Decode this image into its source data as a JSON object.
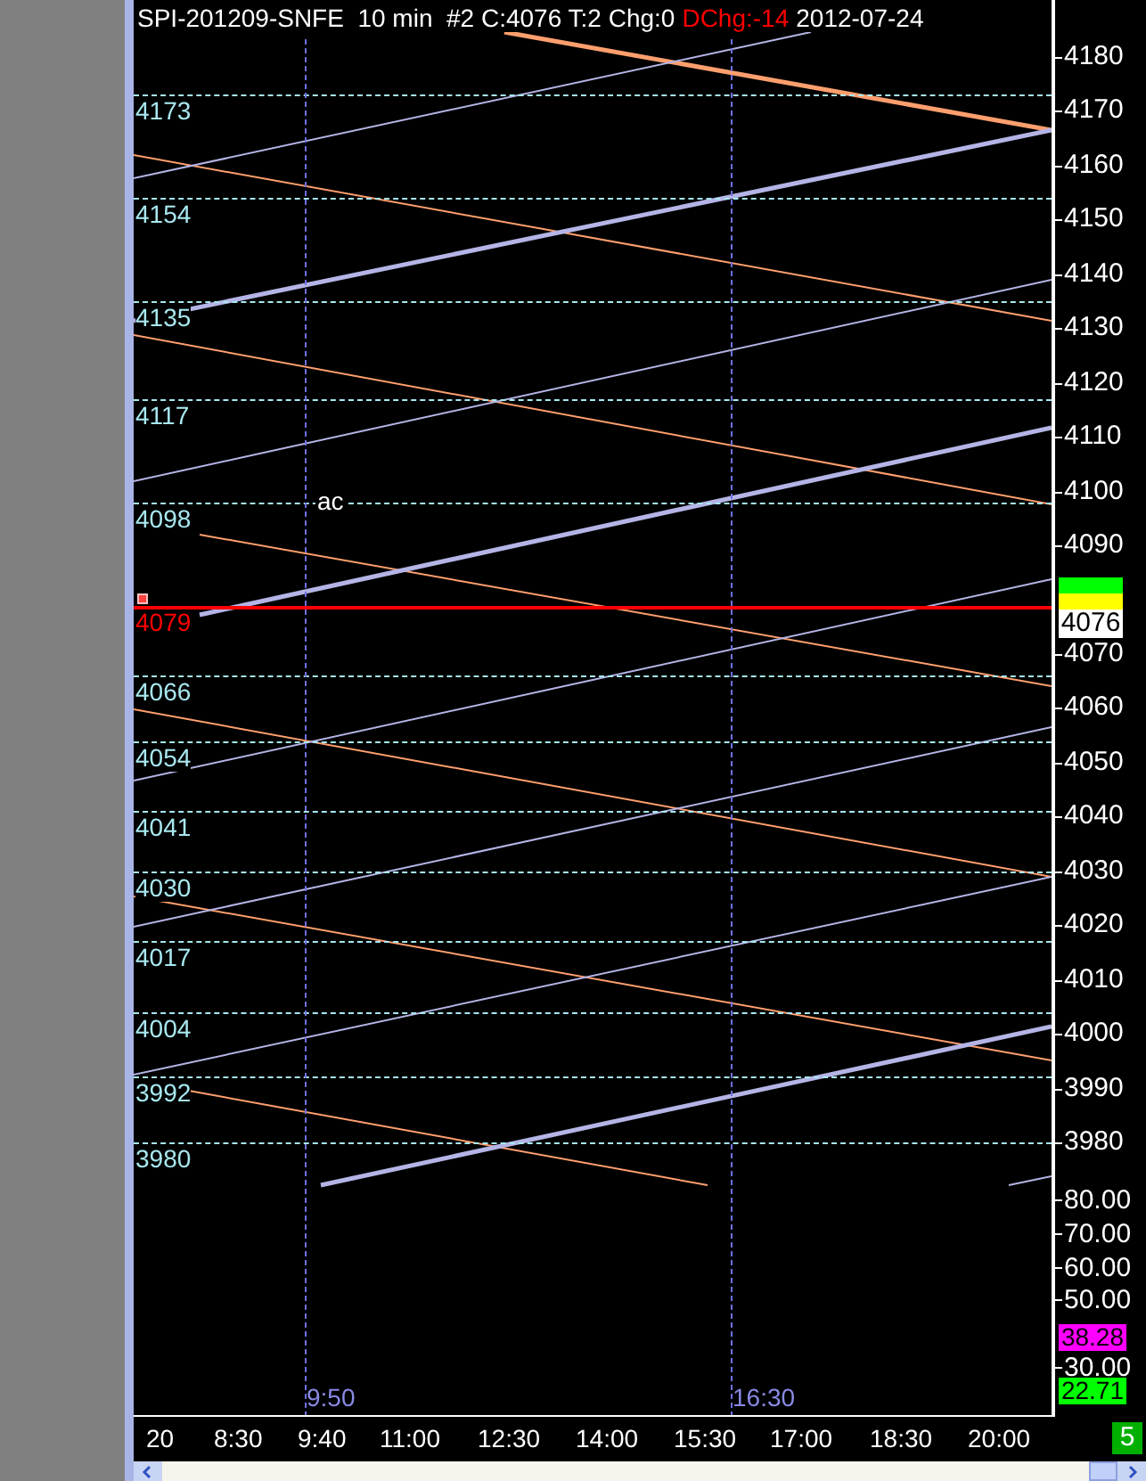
{
  "header": [
    {
      "text": "SPI-201209-SNFE  10 min  #2 C:4076 T:2 Chg:0",
      "color": "#ffffff"
    },
    {
      "text": "DChg:-14",
      "color": "#ff0000"
    },
    {
      "text": "2012-07-24",
      "color": "#ffffff"
    }
  ],
  "levels": [
    {
      "label": "4173",
      "color": "#a8e8f0"
    },
    {
      "label": "4154",
      "color": "#a8e8f0"
    },
    {
      "label": "4135",
      "color": "#a8e8f0"
    },
    {
      "label": "4117",
      "color": "#a8e8f0"
    },
    {
      "label": "4098",
      "color": "#a8e8f0"
    },
    {
      "label": "4079",
      "color": "#ff0000"
    },
    {
      "label": "4066",
      "color": "#a8e8f0"
    },
    {
      "label": "4054",
      "color": "#a8e8f0"
    },
    {
      "label": "4041",
      "color": "#a8e8f0"
    },
    {
      "label": "4030",
      "color": "#a8e8f0"
    },
    {
      "label": "4017",
      "color": "#a8e8f0"
    },
    {
      "label": "4004",
      "color": "#a8e8f0"
    },
    {
      "label": "3992",
      "color": "#a8e8f0"
    },
    {
      "label": "3980",
      "color": "#a8e8f0"
    }
  ],
  "note": "ac",
  "price_axis": [
    "4180",
    "4170",
    "4160",
    "4150",
    "4140",
    "4130",
    "4120",
    "4110",
    "4100",
    "4090",
    "4070",
    "4060",
    "4050",
    "4040",
    "4030",
    "4020",
    "4010",
    "4000",
    "3990",
    "3980"
  ],
  "last_price": "4076",
  "indicator_axis": [
    "80.00",
    "70.00",
    "60.00",
    "50.00",
    "30.00"
  ],
  "indicator_tags": [
    {
      "text": "38.28",
      "color": "#ff00ff"
    },
    {
      "text": "22.71",
      "color": "#00ff00"
    }
  ],
  "markers": [
    {
      "time": "9:50"
    },
    {
      "time": "16:30"
    }
  ],
  "time_axis": [
    "20",
    "8:30",
    "9:40",
    "11:00",
    "12:30",
    "14:00",
    "15:30",
    "17:00",
    "18:30",
    "20:00"
  ],
  "bar_count": "5"
}
